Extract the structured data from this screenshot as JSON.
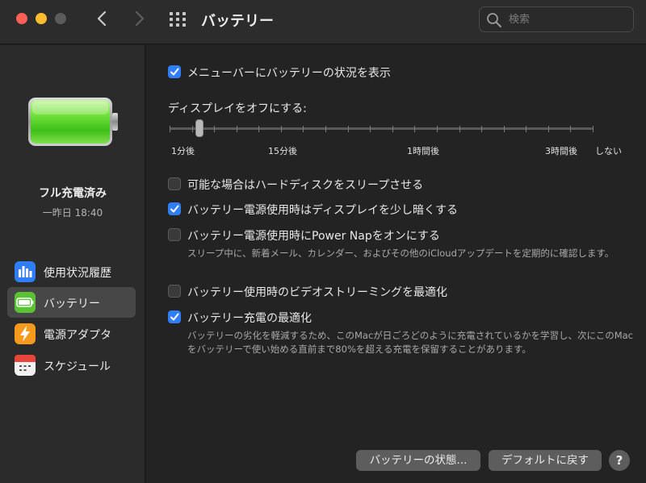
{
  "window": {
    "title": "バッテリー",
    "search_placeholder": "検索"
  },
  "sidebar": {
    "battery_status": "フル充電済み",
    "battery_time": "一昨日 18:40",
    "battery_level": 1.0,
    "items": [
      {
        "label": "使用状況履歴",
        "icon": "usage-history-icon",
        "active": false
      },
      {
        "label": "バッテリー",
        "icon": "battery-icon",
        "active": true
      },
      {
        "label": "電源アダプタ",
        "icon": "power-adapter-icon",
        "active": false
      },
      {
        "label": "スケジュール",
        "icon": "calendar-icon",
        "active": false
      }
    ]
  },
  "main": {
    "show_in_menubar": {
      "label": "メニューバーにバッテリーの状況を表示",
      "checked": true
    },
    "display_off": {
      "title": "ディスプレイをオフにする:",
      "labels": [
        "1分後",
        "15分後",
        "1時間後",
        "3時間後",
        "しない"
      ],
      "value_label": "1分後"
    },
    "options": [
      {
        "label": "可能な場合はハードディスクをスリープさせる",
        "checked": false,
        "description": ""
      },
      {
        "label": "バッテリー電源使用時はディスプレイを少し暗くする",
        "checked": true,
        "description": ""
      },
      {
        "label": "バッテリー電源使用時にPower Napをオンにする",
        "checked": false,
        "description": "スリープ中に、新着メール、カレンダー、およびその他のiCloudアップデートを定期的に確認します。"
      },
      {
        "label": "バッテリー使用時のビデオストリーミングを最適化",
        "checked": false,
        "description": ""
      },
      {
        "label": "バッテリー充電の最適化",
        "checked": true,
        "description": "バッテリーの劣化を軽減するため、このMacが日ごろどのように充電されているかを学習し、次にこのMacをバッテリーで使い始める直前まで80%を超える充電を保留することがあります。"
      }
    ],
    "buttons": {
      "battery_health": "バッテリーの状態...",
      "restore_defaults": "デフォルトに戻す",
      "help": "?"
    }
  },
  "colors": {
    "accent": "#2f7ef6",
    "battery_green": "#5fd631",
    "close": "#fe5f57",
    "minimize": "#febc2e"
  }
}
